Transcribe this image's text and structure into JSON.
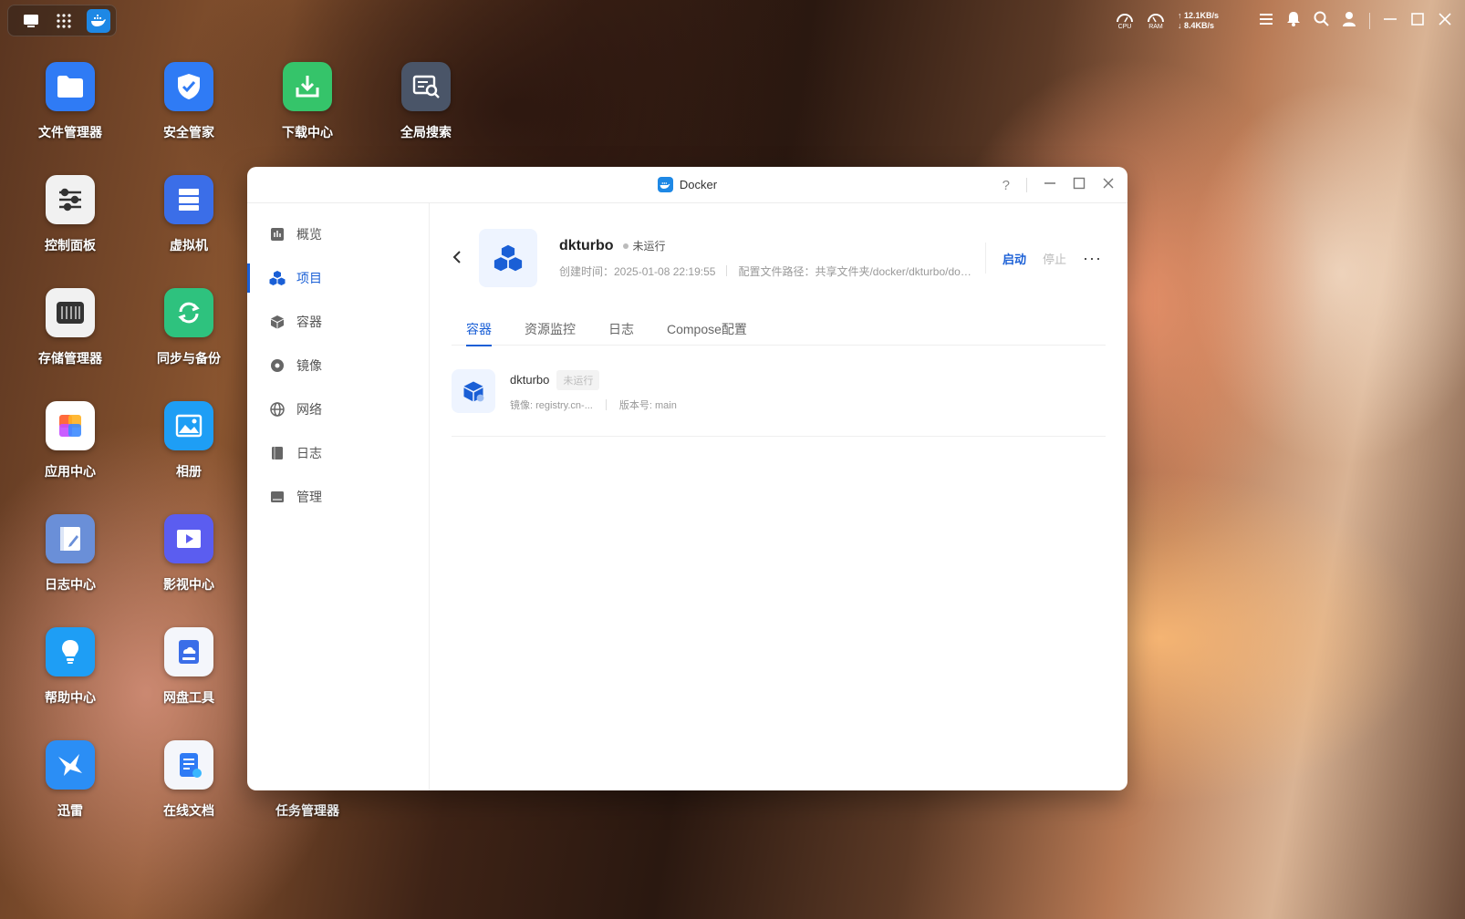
{
  "taskbar": {
    "net_up": "↑ 12.1KB/s",
    "net_down": "↓ 8.4KB/s",
    "cpu_label": "CPU",
    "ram_label": "RAM"
  },
  "desktop": {
    "icons": [
      {
        "label": "文件管理器",
        "color": "#2f7bf5"
      },
      {
        "label": "安全管家",
        "color": "#2f7bf5"
      },
      {
        "label": "下载中心",
        "color": "#35c46a"
      },
      {
        "label": "全局搜索",
        "color": "#4a5568"
      },
      {
        "label": "控制面板",
        "color": "#f1f1f1"
      },
      {
        "label": "虚拟机",
        "color": "#3b6ee8"
      },
      {
        "label": "存储管理器",
        "color": "#f1f1f1"
      },
      {
        "label": "同步与备份",
        "color": "#2ec27e"
      },
      {
        "label": "应用中心",
        "color": "#ffffff"
      },
      {
        "label": "相册",
        "color": "#1e9ef5"
      },
      {
        "label": "日志中心",
        "color": "#6a8fd8"
      },
      {
        "label": "影视中心",
        "color": "#5b5df0"
      },
      {
        "label": "帮助中心",
        "color": "#1e9ef5"
      },
      {
        "label": "网盘工具",
        "color": "#f4f6fb"
      },
      {
        "label": "迅雷",
        "color": "#2b8ef5"
      },
      {
        "label": "在线文档",
        "color": "#f4f6fb"
      },
      {
        "label": "任务管理器",
        "color": ""
      }
    ]
  },
  "window": {
    "title": "Docker",
    "help": "?"
  },
  "sidebar": {
    "items": [
      {
        "label": "概览"
      },
      {
        "label": "项目"
      },
      {
        "label": "容器"
      },
      {
        "label": "镜像"
      },
      {
        "label": "网络"
      },
      {
        "label": "日志"
      },
      {
        "label": "管理"
      }
    ]
  },
  "project": {
    "name": "dkturbo",
    "status": "未运行",
    "created": "创建时间：2025-01-08 22:19:55",
    "config_path": "配置文件路径：共享文件夹/docker/dkturbo/docker-compose.yml",
    "start": "启动",
    "stop": "停止",
    "more": "···"
  },
  "tabs": [
    {
      "label": "容器"
    },
    {
      "label": "资源监控"
    },
    {
      "label": "日志"
    },
    {
      "label": "Compose配置"
    }
  ],
  "containers": [
    {
      "name": "dkturbo",
      "status": "未运行",
      "image": "镜像: registry.cn-...",
      "version": "版本号: main"
    }
  ]
}
